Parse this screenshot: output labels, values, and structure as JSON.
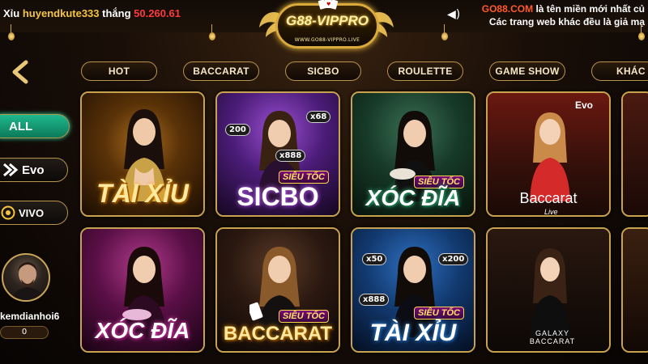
{
  "ticker": {
    "prefix": "Xỉu",
    "user": "huyendkute333",
    "word": "thắng",
    "amount": "50.260.61"
  },
  "notice": {
    "domain": "GO88.COM",
    "line1_rest": " là tên miền mới nhất củ",
    "line2": "Các trang web khác đều là giả mạ"
  },
  "logo": {
    "brand": "G88-VIPPRO",
    "site": "WWW.GO88-VIPPRO.LIVE"
  },
  "tabs": [
    "HOT",
    "BACCARAT",
    "SICBO",
    "ROULETTE",
    "GAME SHOW",
    "KHÁC"
  ],
  "providers": [
    {
      "label": "ALL",
      "icon": ""
    },
    {
      "label": "Evo",
      "icon": "evo-logo-icon"
    },
    {
      "label": "VIVO",
      "icon": "vivo-logo-icon"
    }
  ],
  "profile": {
    "username": "kemdianhoi6",
    "balance": "0"
  },
  "games": [
    {
      "title": "TÀI XỈU",
      "badge": "",
      "mult1": "",
      "mult2": "",
      "sub": "",
      "theme": "gold"
    },
    {
      "title": "SICBO",
      "badge": "SIÊU TỐC",
      "mult1": "200",
      "mult2": "x68",
      "mult3": "x888",
      "sub": "",
      "theme": "purple"
    },
    {
      "title": "XÓC ĐĨA",
      "badge": "SIÊU TỐC",
      "mult1": "",
      "mult2": "",
      "sub": "",
      "theme": "green"
    },
    {
      "title": "Baccarat",
      "badge": "",
      "mult1": "",
      "mult2": "",
      "sub": "Live",
      "provider": "Evo",
      "theme": "red"
    },
    {
      "title": "XÓC ĐĨA",
      "badge": "",
      "mult1": "",
      "mult2": "",
      "sub": "",
      "theme": "pink"
    },
    {
      "title": "BACCARAT",
      "badge": "SIÊU TỐC",
      "mult1": "",
      "mult2": "",
      "sub": "",
      "theme": "dark"
    },
    {
      "title": "TÀI XỈU",
      "badge": "SIÊU TỐC",
      "mult1": "x50",
      "mult2": "x200",
      "mult3": "x888",
      "sub": "",
      "theme": "blue"
    },
    {
      "title": "GALAXY BACCARAT",
      "badge": "",
      "mult1": "",
      "mult2": "",
      "sub": "",
      "theme": "casino"
    }
  ],
  "colors": {
    "accent": "#c8a24e",
    "all_tab": "#1fb88e",
    "winner_name": "#f5c542",
    "amount": "#ff3a3a",
    "domain": "#ff5a2a"
  }
}
